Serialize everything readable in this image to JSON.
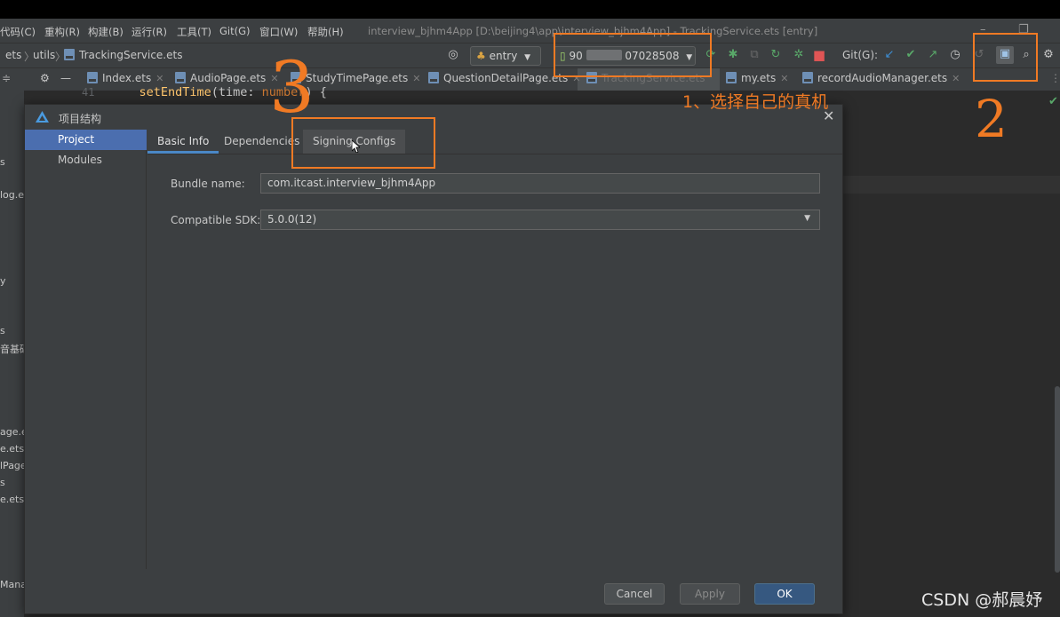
{
  "menubar": {
    "items": [
      "代码(C)",
      "重构(R)",
      "构建(B)",
      "运行(R)",
      "工具(T)",
      "Git(G)",
      "窗口(W)",
      "帮助(H)"
    ],
    "window_title": "interview_bjhm4App [D:\\beijing4\\app\\interview_bjhm4App] - TrackingService.ets [entry]"
  },
  "toolbar": {
    "breadcrumb": [
      "ets",
      "utils",
      "TrackingService.ets"
    ],
    "run_config": "entry",
    "device_prefix": "90",
    "device_suffix": "07028508",
    "git_label": "Git(G):"
  },
  "tabs": [
    {
      "label": "Index.ets"
    },
    {
      "label": "AudioPage.ets"
    },
    {
      "label": "StudyTimePage.ets"
    },
    {
      "label": "QuestionDetailPage.ets"
    },
    {
      "label": "TrackingService.ets"
    },
    {
      "label": "my.ets"
    },
    {
      "label": "recordAudioManager.ets"
    }
  ],
  "sidebar_fragments": [
    "s",
    "log.e",
    "y",
    "s",
    "音基础",
    "age.e",
    "e.ets",
    "lPage",
    "s",
    "e.ets",
    "Manag"
  ],
  "editor": {
    "line_number": "41",
    "fn_name": "setEndTime",
    "param": "time: ",
    "type": "number",
    "rest": ") {"
  },
  "dialog": {
    "title": "项目结构",
    "nav": [
      "Project",
      "Modules"
    ],
    "subtabs": [
      "Basic Info",
      "Dependencies",
      "Signing Configs"
    ],
    "fields": {
      "bundle_label": "Bundle name:",
      "bundle_value": "com.itcast.interview_bjhm4App",
      "sdk_label": "Compatible SDK:",
      "sdk_value": "5.0.0(12)"
    },
    "buttons": {
      "cancel": "Cancel",
      "apply": "Apply",
      "ok": "OK"
    }
  },
  "annotations": {
    "step1": "1、选择自己的真机",
    "num2": "2",
    "num3": "3",
    "color": "#f07a24"
  },
  "watermark": "CSDN @郝晨妤"
}
